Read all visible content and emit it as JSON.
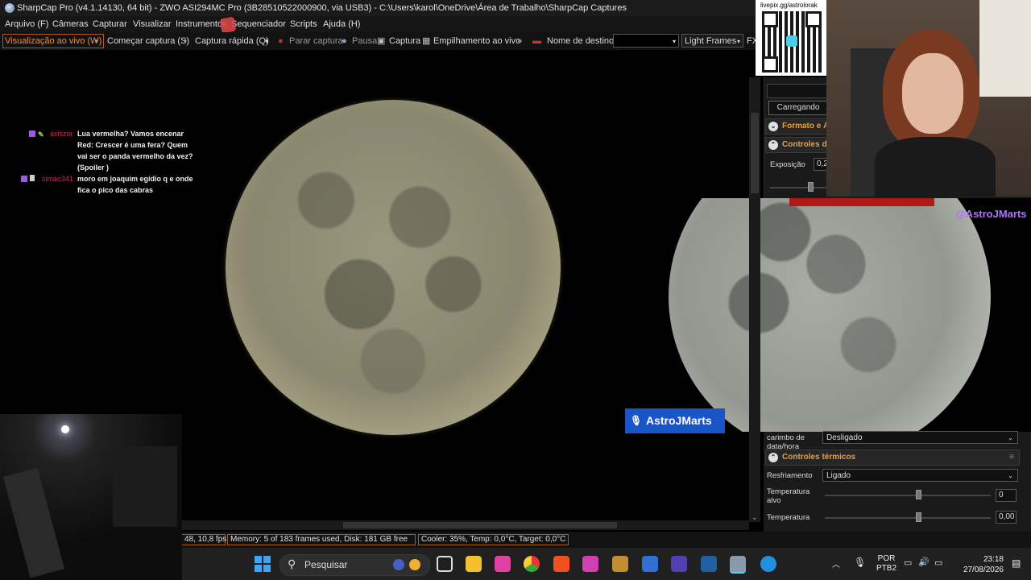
{
  "window": {
    "title": "SharpCap Pro (v4.1.14130, 64 bit) - ZWO ASI294MC Pro (3B28510522000900, via USB3) - C:\\Users\\karol\\OneDrive\\Área de Trabalho\\SharpCap Captures"
  },
  "menu": [
    "Arquivo (F)",
    "Câmeras",
    "Capturar",
    "Visualizar",
    "Instrumentos",
    "Sequenciador",
    "Scripts",
    "Ajuda (H)"
  ],
  "toolbar": {
    "live_view": "Visualização ao vivo (W)",
    "start_capture": "Começar captura (S)",
    "quick_capture": "Captura rápida (Q)",
    "stop_capture": "Parar captura",
    "pause": "Pausa",
    "snapshot": "Captura",
    "live_stack": "Empilhamento ao vivo",
    "target_name": "Nome de destino",
    "target_value": "",
    "frame_type": "Light Frames",
    "fx": "FX"
  },
  "chat": [
    {
      "user": "axiszor",
      "message": "Lua vermelha? Vamos encenar Red: Crescer é uma fera? Quem vai ser o panda vermelho da vez? (Spoiler )"
    },
    {
      "user": "simao341",
      "message": "moro em joaquim egídio q e onde fica o pico das cabras"
    }
  ],
  "stream": {
    "qr_url": "livepix.gg/astrolorak",
    "name_badge": "AstroJMarts",
    "handle": "@AstroJMarts"
  },
  "panel": {
    "loading_button": "Carregando",
    "format_section": "Formato e Á",
    "camera_controls_section": "Controles da",
    "exposure_label": "Exposição",
    "exposure_value": "0,2",
    "timestamp_label": "carimbo de data/hora",
    "timestamp_value": "Desligado",
    "thermal_section": "Controles térmicos",
    "cooling_label": "Resfriamento",
    "cooling_value": "Ligado",
    "target_temp_label": "Temperatura alvo",
    "target_temp_value": "0",
    "temp_label": "Temperatura",
    "temp_value": "0,00"
  },
  "status": {
    "fps": "48, 10,8 fps",
    "memory": "Memory: 5 of 183 frames used, Disk: 181 GB free",
    "cooler": "Cooler: 35%, Temp: 0,0°C, Target: 0,0°C"
  },
  "taskbar": {
    "search_placeholder": "Pesquisar",
    "lang_top": "POR",
    "lang_bottom": "PTB2",
    "time": "23:18",
    "date": "27/08/2026"
  },
  "colors": {
    "accent": "#e89040",
    "badge_blue": "#1a55c8",
    "handle_purple": "#b070ff",
    "chat_user": "#c8305a"
  }
}
